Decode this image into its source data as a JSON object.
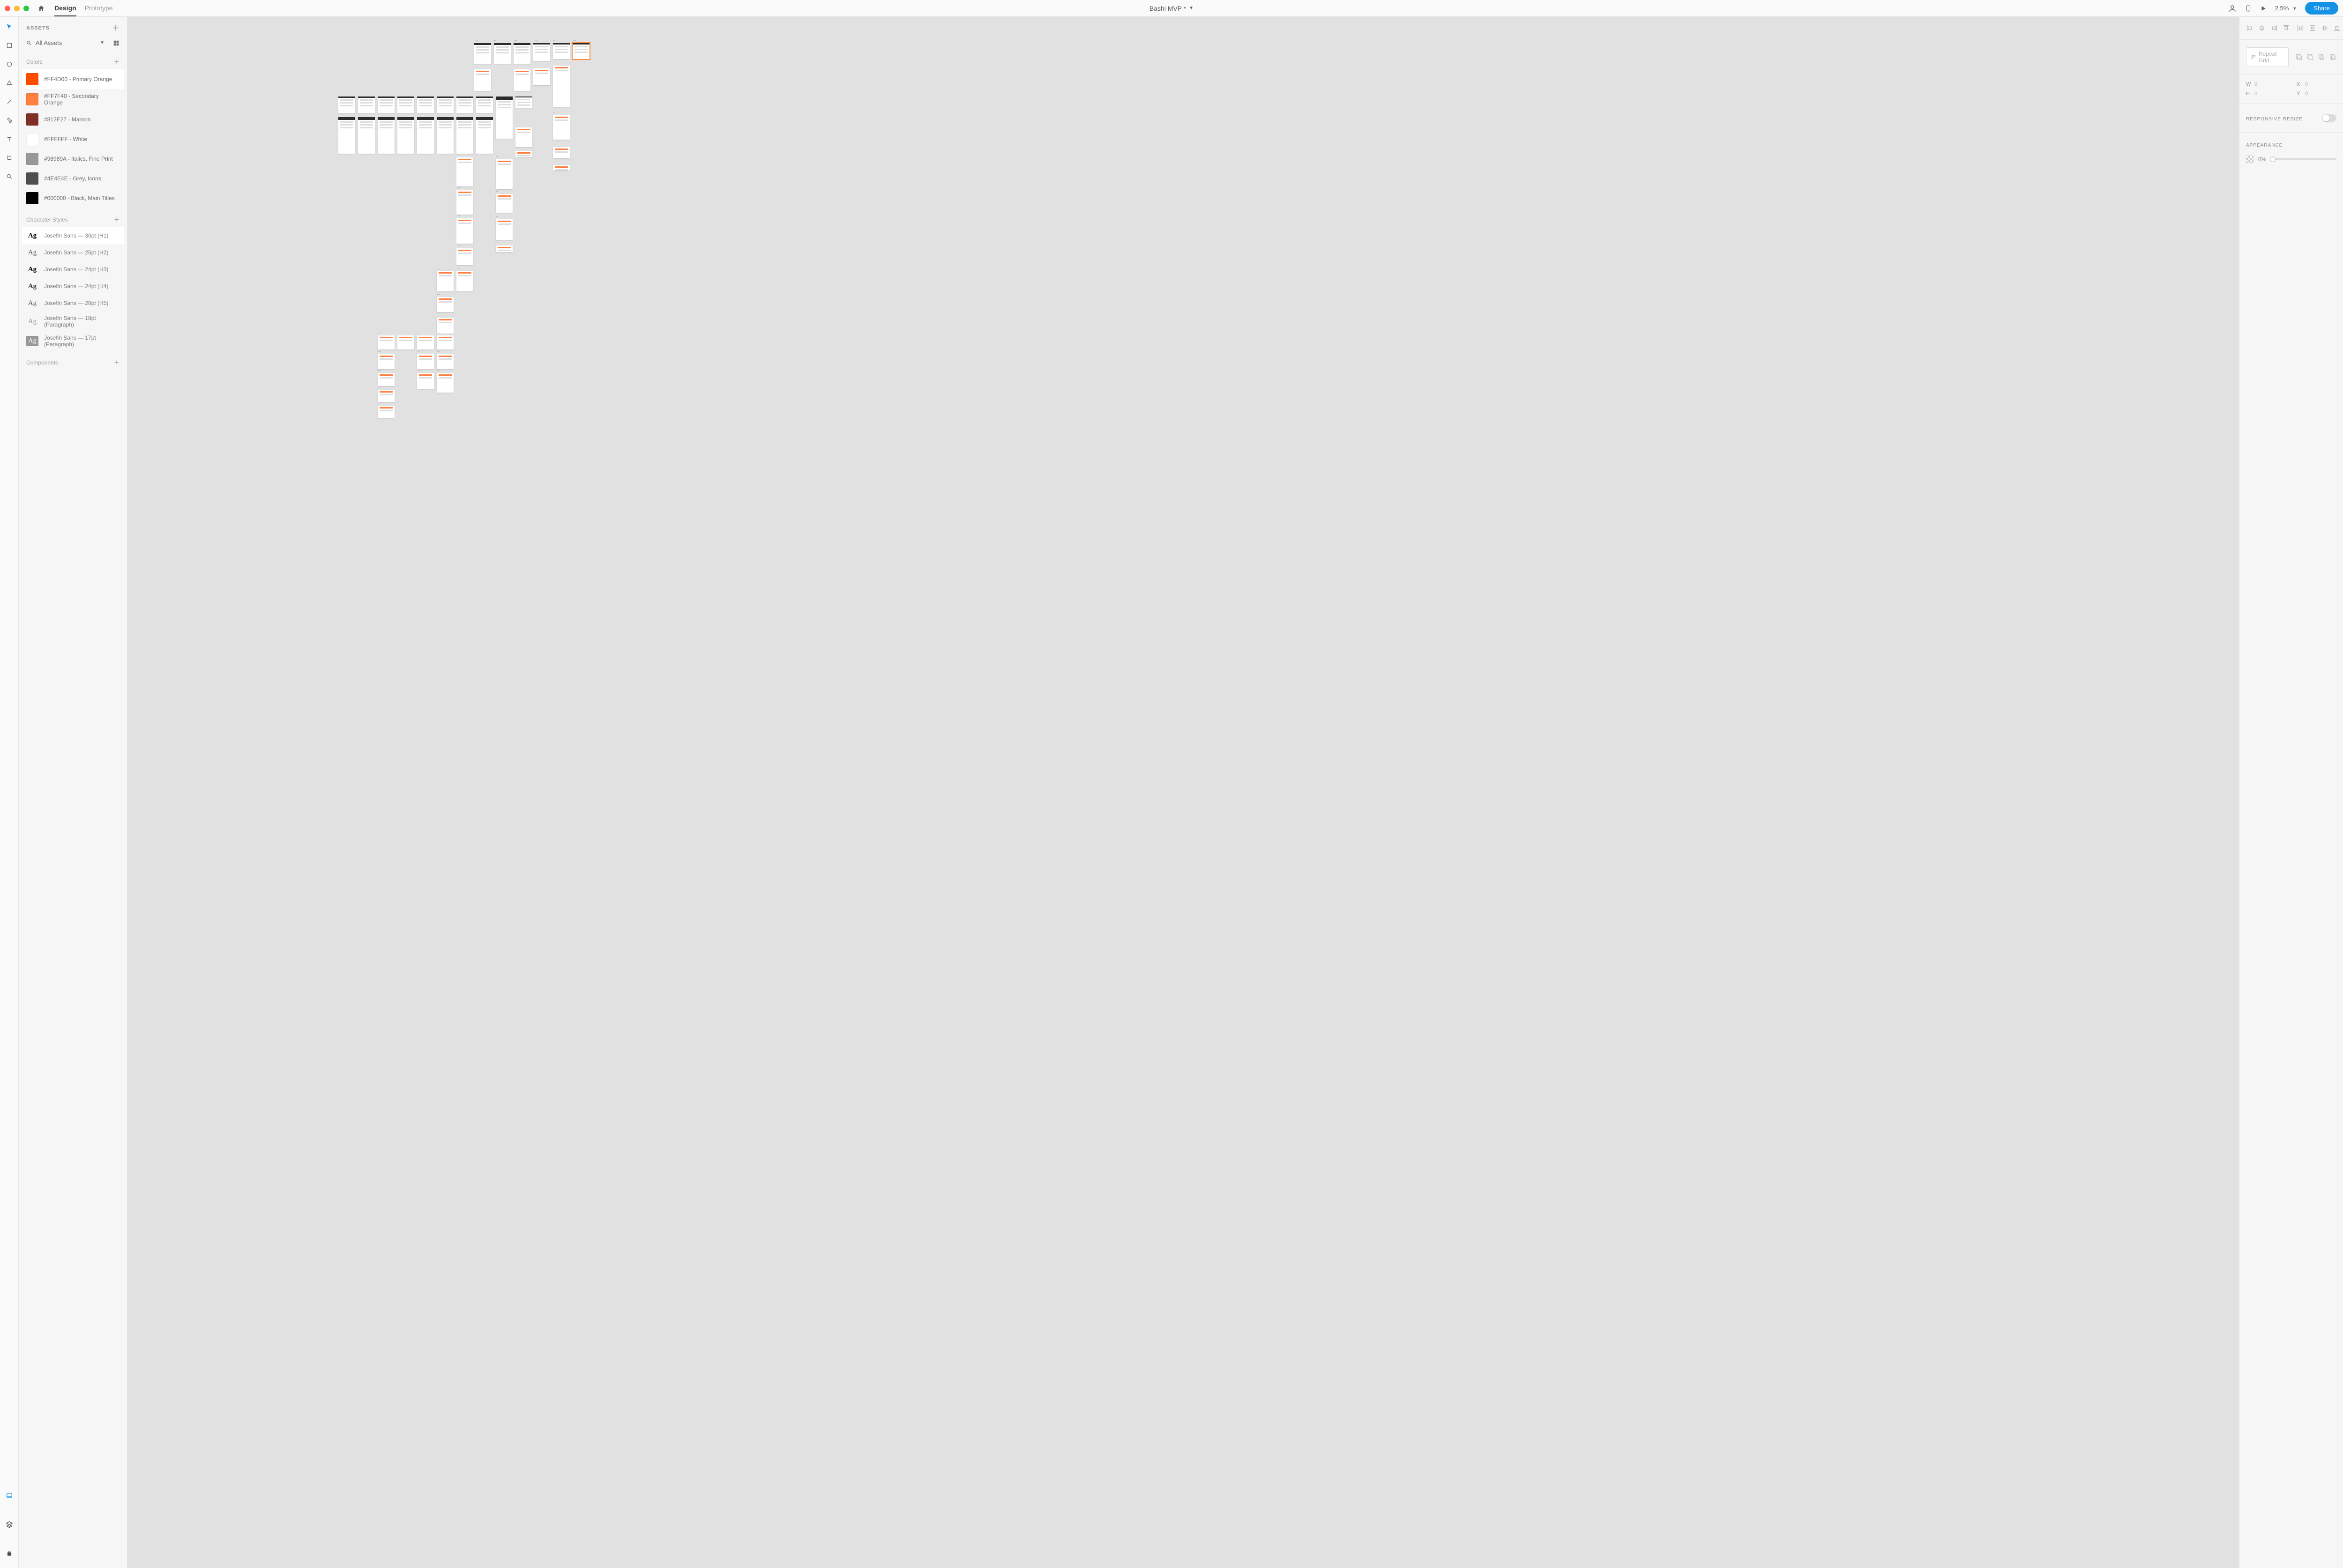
{
  "topbar": {
    "tabs": {
      "design": "Design",
      "prototype": "Prototype"
    },
    "doc_title": "Bashi MVP *",
    "zoom": "2.5%",
    "share": "Share"
  },
  "assets_panel": {
    "title": "ASSETS",
    "search_label": "All Assets",
    "colors_title": "Colors",
    "colors": [
      {
        "hex": "#FF4D00",
        "label": "#FF4D00 - Primary Orange",
        "selected": true
      },
      {
        "hex": "#FF7F40",
        "label": "#FF7F40 - Secondary Orange",
        "selected": false
      },
      {
        "hex": "#812E27",
        "label": "#812E27 - Maroon",
        "selected": false
      },
      {
        "hex": "#FFFFFF",
        "label": "#FFFFFF - White",
        "selected": false
      },
      {
        "hex": "#98989A",
        "label": "#98989A - Italics, Fine Print",
        "selected": false
      },
      {
        "hex": "#4E4E4E",
        "label": "#4E4E4E - Grey, Icons",
        "selected": false
      },
      {
        "hex": "#000000",
        "label": "#000000 - Black, Main Titles",
        "selected": false
      }
    ],
    "char_styles_title": "Character Styles",
    "char_styles": [
      {
        "label": "Josefin Sans — 30pt (H1)",
        "variant": "bold",
        "selected": true
      },
      {
        "label": "Josefin Sans — 25pt (H2)",
        "variant": "reg",
        "selected": false
      },
      {
        "label": "Josefin Sans — 24pt (H3)",
        "variant": "bold",
        "selected": false
      },
      {
        "label": "Josefin Sans — 24pt (H4)",
        "variant": "med",
        "selected": false
      },
      {
        "label": "Josefin Sans — 20pt (H5)",
        "variant": "reg",
        "selected": false
      },
      {
        "label": "Josefin Sans — 18pt (Paragraph)",
        "variant": "light",
        "selected": false
      },
      {
        "label": "Josefin Sans — 17pt (Paragraph)",
        "variant": "inverted",
        "selected": false
      }
    ],
    "components_title": "Components"
  },
  "right_panel": {
    "repeat_grid": "Repeat Grid",
    "w_label": "W",
    "w_val": "0",
    "h_label": "H",
    "h_val": "0",
    "x_label": "X",
    "x_val": "0",
    "y_label": "Y",
    "y_val": "0",
    "responsive": "RESPONSIVE RESIZE",
    "appearance": "APPEARANCE",
    "opacity": "0%"
  },
  "artboards": [
    {
      "l": 740,
      "t": 56,
      "w": 36,
      "h": 44,
      "dots": true
    },
    {
      "l": 782,
      "t": 56,
      "w": 36,
      "h": 44,
      "dots": true
    },
    {
      "l": 824,
      "t": 56,
      "w": 36,
      "h": 44,
      "dots": true
    },
    {
      "l": 866,
      "t": 56,
      "w": 36,
      "h": 38,
      "dots": true
    },
    {
      "l": 908,
      "t": 56,
      "w": 36,
      "h": 34,
      "dots": true
    },
    {
      "l": 950,
      "t": 56,
      "w": 36,
      "h": 34,
      "selected": true,
      "dots": true
    },
    {
      "l": 740,
      "t": 112,
      "w": 36,
      "h": 46
    },
    {
      "l": 824,
      "t": 112,
      "w": 36,
      "h": 46
    },
    {
      "l": 866,
      "t": 110,
      "w": 36,
      "h": 36
    },
    {
      "l": 908,
      "t": 104,
      "w": 36,
      "h": 88
    },
    {
      "l": 450,
      "t": 170,
      "w": 36,
      "h": 36,
      "dots": true
    },
    {
      "l": 492,
      "t": 170,
      "w": 36,
      "h": 36,
      "dots": true
    },
    {
      "l": 534,
      "t": 170,
      "w": 36,
      "h": 36,
      "dots": true
    },
    {
      "l": 576,
      "t": 170,
      "w": 36,
      "h": 36,
      "dots": true
    },
    {
      "l": 618,
      "t": 170,
      "w": 36,
      "h": 36,
      "dots": true
    },
    {
      "l": 660,
      "t": 170,
      "w": 36,
      "h": 36,
      "dots": true
    },
    {
      "l": 702,
      "t": 170,
      "w": 36,
      "h": 36,
      "dots": true
    },
    {
      "l": 744,
      "t": 170,
      "w": 36,
      "h": 36,
      "dots": true
    },
    {
      "l": 786,
      "t": 170,
      "w": 36,
      "h": 90,
      "dots": true
    },
    {
      "l": 828,
      "t": 170,
      "w": 36,
      "h": 24,
      "dots": true
    },
    {
      "l": 908,
      "t": 210,
      "w": 36,
      "h": 52,
      "dots": true
    },
    {
      "l": 450,
      "t": 214,
      "w": 36,
      "h": 78
    },
    {
      "l": 492,
      "t": 214,
      "w": 36,
      "h": 78
    },
    {
      "l": 534,
      "t": 214,
      "w": 36,
      "h": 78
    },
    {
      "l": 576,
      "t": 214,
      "w": 36,
      "h": 78
    },
    {
      "l": 618,
      "t": 214,
      "w": 36,
      "h": 78
    },
    {
      "l": 660,
      "t": 214,
      "w": 36,
      "h": 78
    },
    {
      "l": 702,
      "t": 214,
      "w": 36,
      "h": 78
    },
    {
      "l": 744,
      "t": 214,
      "w": 36,
      "h": 78
    },
    {
      "l": 828,
      "t": 236,
      "w": 36,
      "h": 42
    },
    {
      "l": 828,
      "t": 286,
      "w": 36,
      "h": 14
    },
    {
      "l": 908,
      "t": 278,
      "w": 36,
      "h": 24
    },
    {
      "l": 908,
      "t": 316,
      "w": 36,
      "h": 12
    },
    {
      "l": 702,
      "t": 300,
      "w": 36,
      "h": 62,
      "dots": true
    },
    {
      "l": 786,
      "t": 304,
      "w": 36,
      "h": 64,
      "dots": true
    },
    {
      "l": 702,
      "t": 370,
      "w": 36,
      "h": 52,
      "dots": true
    },
    {
      "l": 786,
      "t": 378,
      "w": 36,
      "h": 40,
      "dots": true
    },
    {
      "l": 702,
      "t": 430,
      "w": 36,
      "h": 54,
      "dots": true
    },
    {
      "l": 786,
      "t": 432,
      "w": 36,
      "h": 44,
      "dots": true
    },
    {
      "l": 702,
      "t": 494,
      "w": 36,
      "h": 36,
      "dots": true
    },
    {
      "l": 786,
      "t": 488,
      "w": 36,
      "h": 14,
      "dots": true
    },
    {
      "l": 660,
      "t": 542,
      "w": 36,
      "h": 44,
      "dots": true
    },
    {
      "l": 702,
      "t": 542,
      "w": 36,
      "h": 44,
      "dots": true
    },
    {
      "l": 660,
      "t": 598,
      "w": 36,
      "h": 32,
      "dots": true
    },
    {
      "l": 660,
      "t": 642,
      "w": 36,
      "h": 34,
      "dots": true
    },
    {
      "l": 534,
      "t": 680,
      "w": 36,
      "h": 30,
      "dots": true
    },
    {
      "l": 576,
      "t": 680,
      "w": 36,
      "h": 30,
      "dots": true
    },
    {
      "l": 618,
      "t": 680,
      "w": 36,
      "h": 30,
      "dots": true
    },
    {
      "l": 660,
      "t": 680,
      "w": 36,
      "h": 30,
      "dots": true
    },
    {
      "l": 534,
      "t": 720,
      "w": 36,
      "h": 32,
      "dots": true
    },
    {
      "l": 618,
      "t": 720,
      "w": 36,
      "h": 32,
      "dots": true
    },
    {
      "l": 660,
      "t": 720,
      "w": 36,
      "h": 32,
      "dots": true
    },
    {
      "l": 534,
      "t": 760,
      "w": 36,
      "h": 28,
      "dots": true
    },
    {
      "l": 618,
      "t": 760,
      "w": 36,
      "h": 34,
      "dots": true
    },
    {
      "l": 660,
      "t": 760,
      "w": 36,
      "h": 42,
      "dots": true
    },
    {
      "l": 534,
      "t": 796,
      "w": 36,
      "h": 26,
      "dots": true
    },
    {
      "l": 534,
      "t": 830,
      "w": 36,
      "h": 26,
      "dots": true
    }
  ]
}
